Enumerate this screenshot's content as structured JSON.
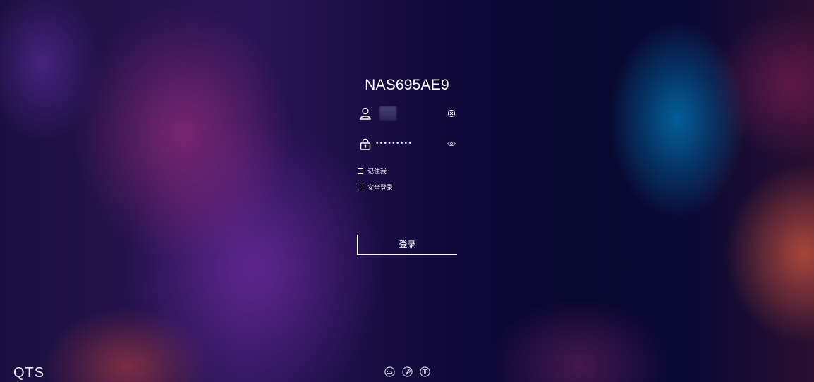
{
  "device": {
    "name": "NAS695AE9"
  },
  "form": {
    "username_value": "",
    "password_value": "•••••••••",
    "remember_label": "记住我",
    "secure_label": "安全登录",
    "login_label": "登录"
  },
  "icons": {
    "user": "user-icon",
    "lock": "lock-icon",
    "clear": "clear-icon",
    "eye": "eye-icon",
    "cloud": "cloud-icon",
    "tools": "tools-icon",
    "apps": "apps-icon"
  },
  "brand": {
    "logo_text": "QTS"
  },
  "colors": {
    "text": "#ffffff",
    "accent_purple": "#872878",
    "accent_blue": "#006eaa",
    "accent_orange": "#be503c"
  }
}
